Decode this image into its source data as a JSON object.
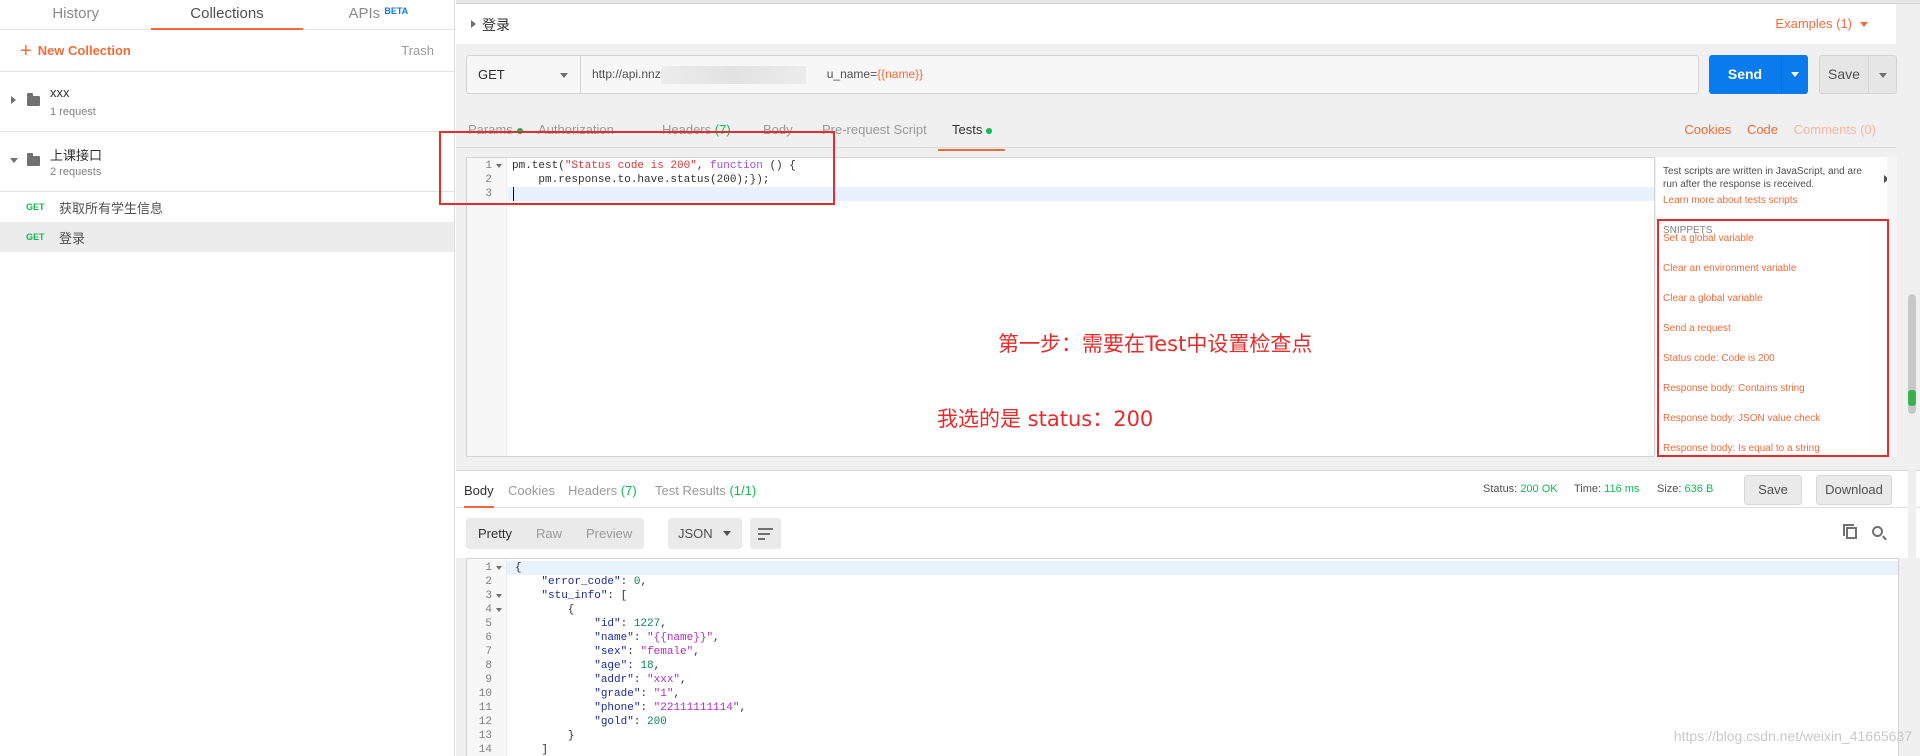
{
  "sidebar": {
    "tabs": [
      {
        "label": "History"
      },
      {
        "label": "Collections"
      },
      {
        "label": "APIs",
        "badge": "BETA"
      }
    ],
    "new_collection": "New Collection",
    "trash": "Trash",
    "collections": [
      {
        "name": "xxx",
        "count": "1 request"
      },
      {
        "name": "上课接口",
        "count": "2 requests"
      }
    ],
    "requests": [
      {
        "method": "GET",
        "name": "获取所有学生信息"
      },
      {
        "method": "GET",
        "name": "登录"
      }
    ]
  },
  "request": {
    "title": "登录",
    "examples": "Examples (1)",
    "method": "GET",
    "url_prefix": "http://api.nnz",
    "url_suffix": "u_name=",
    "url_variable": "{{name}}",
    "send": "Send",
    "save": "Save"
  },
  "req_tabs": [
    {
      "label": "Params"
    },
    {
      "label": "Authorization"
    },
    {
      "label": "Headers",
      "count": "(7)"
    },
    {
      "label": "Body"
    },
    {
      "label": "Pre-request Script"
    },
    {
      "label": "Tests"
    }
  ],
  "req_links": {
    "cookies": "Cookies",
    "code": "Code",
    "comments": "Comments (0)"
  },
  "tests_editor": {
    "lines": [
      "1",
      "2",
      "3"
    ],
    "code": {
      "l1_a": "pm.test(",
      "l1_b": "\"Status code is 200\"",
      "l1_c": ", ",
      "l1_d": "function",
      "l1_e": " () {",
      "l2": "    pm.response.to.have.status(200);});"
    }
  },
  "annotations": {
    "step": "第一步：需要在Test中设置检查点",
    "choice": "我选的是 status：200"
  },
  "snippets_panel": {
    "info": "Test scripts are written in JavaScript, and are run after the response is received.",
    "learn_more": "Learn more about tests scripts",
    "header": "SNIPPETS",
    "items": [
      "Set a global variable",
      "Clear an environment variable",
      "Clear a global variable",
      "Send a request",
      "Status code: Code is 200",
      "Response body: Contains string",
      "Response body: JSON value check",
      "Response body: Is equal to a string"
    ]
  },
  "response": {
    "tabs": [
      {
        "label": "Body"
      },
      {
        "label": "Cookies"
      },
      {
        "label": "Headers",
        "count": "(7)"
      },
      {
        "label": "Test Results",
        "count": "(1/1)"
      }
    ],
    "status_label": "Status:",
    "status_value": "200 OK",
    "time_label": "Time:",
    "time_value": "116 ms",
    "size_label": "Size:",
    "size_value": "636 B",
    "save": "Save",
    "download": "Download",
    "formats": [
      "Pretty",
      "Raw",
      "Preview"
    ],
    "format_type": "JSON",
    "body_lines": [
      {
        "n": "1",
        "t": "{"
      },
      {
        "n": "2",
        "t": "    \"error_code\": 0,"
      },
      {
        "n": "3",
        "t": "    \"stu_info\": ["
      },
      {
        "n": "4",
        "t": "        {"
      },
      {
        "n": "5",
        "t": "            \"id\": 1227,"
      },
      {
        "n": "6",
        "t": "            \"name\": \"{{name}}\","
      },
      {
        "n": "7",
        "t": "            \"sex\": \"female\","
      },
      {
        "n": "8",
        "t": "            \"age\": 18,"
      },
      {
        "n": "9",
        "t": "            \"addr\": \"xxx\","
      },
      {
        "n": "10",
        "t": "            \"grade\": \"1\","
      },
      {
        "n": "11",
        "t": "            \"phone\": \"22111111114\","
      },
      {
        "n": "12",
        "t": "            \"gold\": 200"
      },
      {
        "n": "13",
        "t": "        }"
      },
      {
        "n": "14",
        "t": "    ]"
      }
    ]
  },
  "watermark": "https://blog.csdn.net/weixin_41665637",
  "colors": {
    "accent": "#f26b3a",
    "primary": "#097bed",
    "success": "#0cbb52",
    "annotation": "#e52b2b"
  }
}
